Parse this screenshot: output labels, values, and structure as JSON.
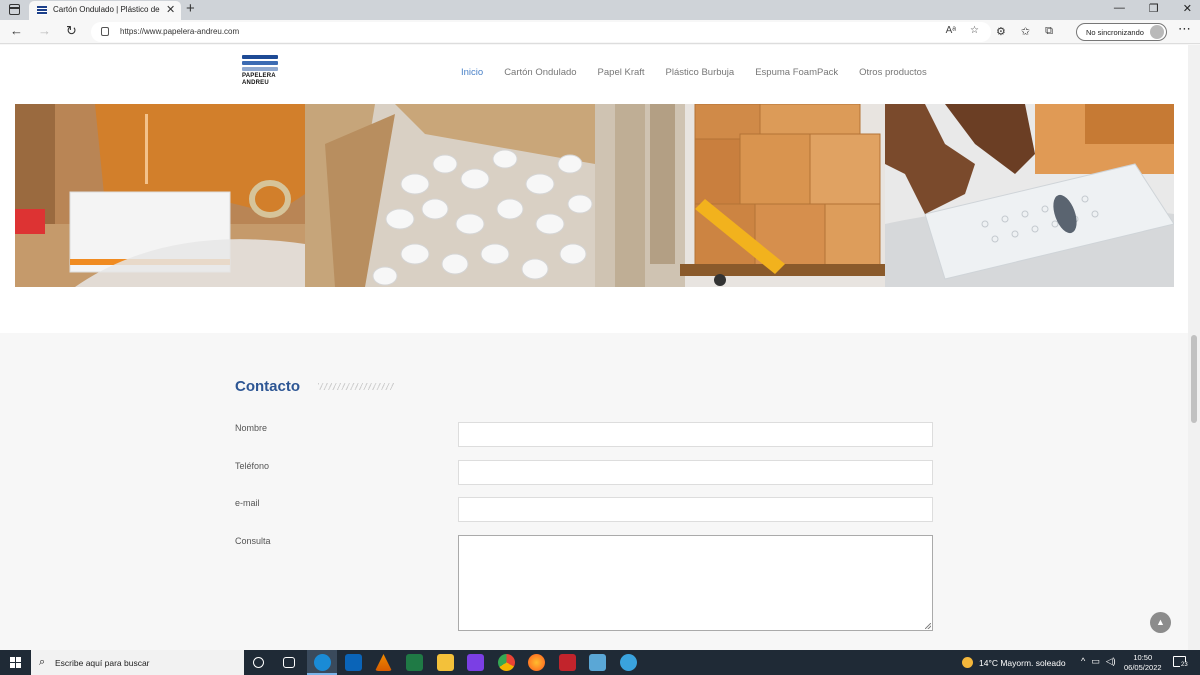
{
  "browser": {
    "tab_title": "Cartón Ondulado | Plástico de B",
    "url": "https://www.papelera-andreu.com",
    "sync_label": "No sincronizando"
  },
  "site": {
    "logo_line1": "PAPELERA",
    "logo_line2": "ANDREU",
    "nav": [
      {
        "label": "Inicio",
        "active": true
      },
      {
        "label": "Cartón Ondulado"
      },
      {
        "label": "Papel Kraft"
      },
      {
        "label": "Plástico Burbuja"
      },
      {
        "label": "Espuma FoamPack"
      },
      {
        "label": "Otros productos"
      }
    ],
    "gallery": [
      {
        "subject": "person-packing-box",
        "color": "#c98a4a"
      },
      {
        "subject": "packing-peanuts-box",
        "color": "#ececec"
      },
      {
        "subject": "pallet-jack-boxes",
        "color": "#d59a5f"
      },
      {
        "subject": "bubble-wrap-roll",
        "color": "#d9dde0"
      }
    ]
  },
  "contact": {
    "title": "Contacto",
    "fields": [
      {
        "label": "Nombre",
        "value": ""
      },
      {
        "label": "Teléfono",
        "value": ""
      },
      {
        "label": "e-mail",
        "value": ""
      },
      {
        "label": "Consulta",
        "value": ""
      }
    ]
  },
  "taskbar": {
    "search_placeholder": "Escribe aquí para buscar",
    "weather": "14°C  Mayorm. soleado",
    "time": "10:50",
    "date": "06/05/2022",
    "notifications": "23"
  }
}
